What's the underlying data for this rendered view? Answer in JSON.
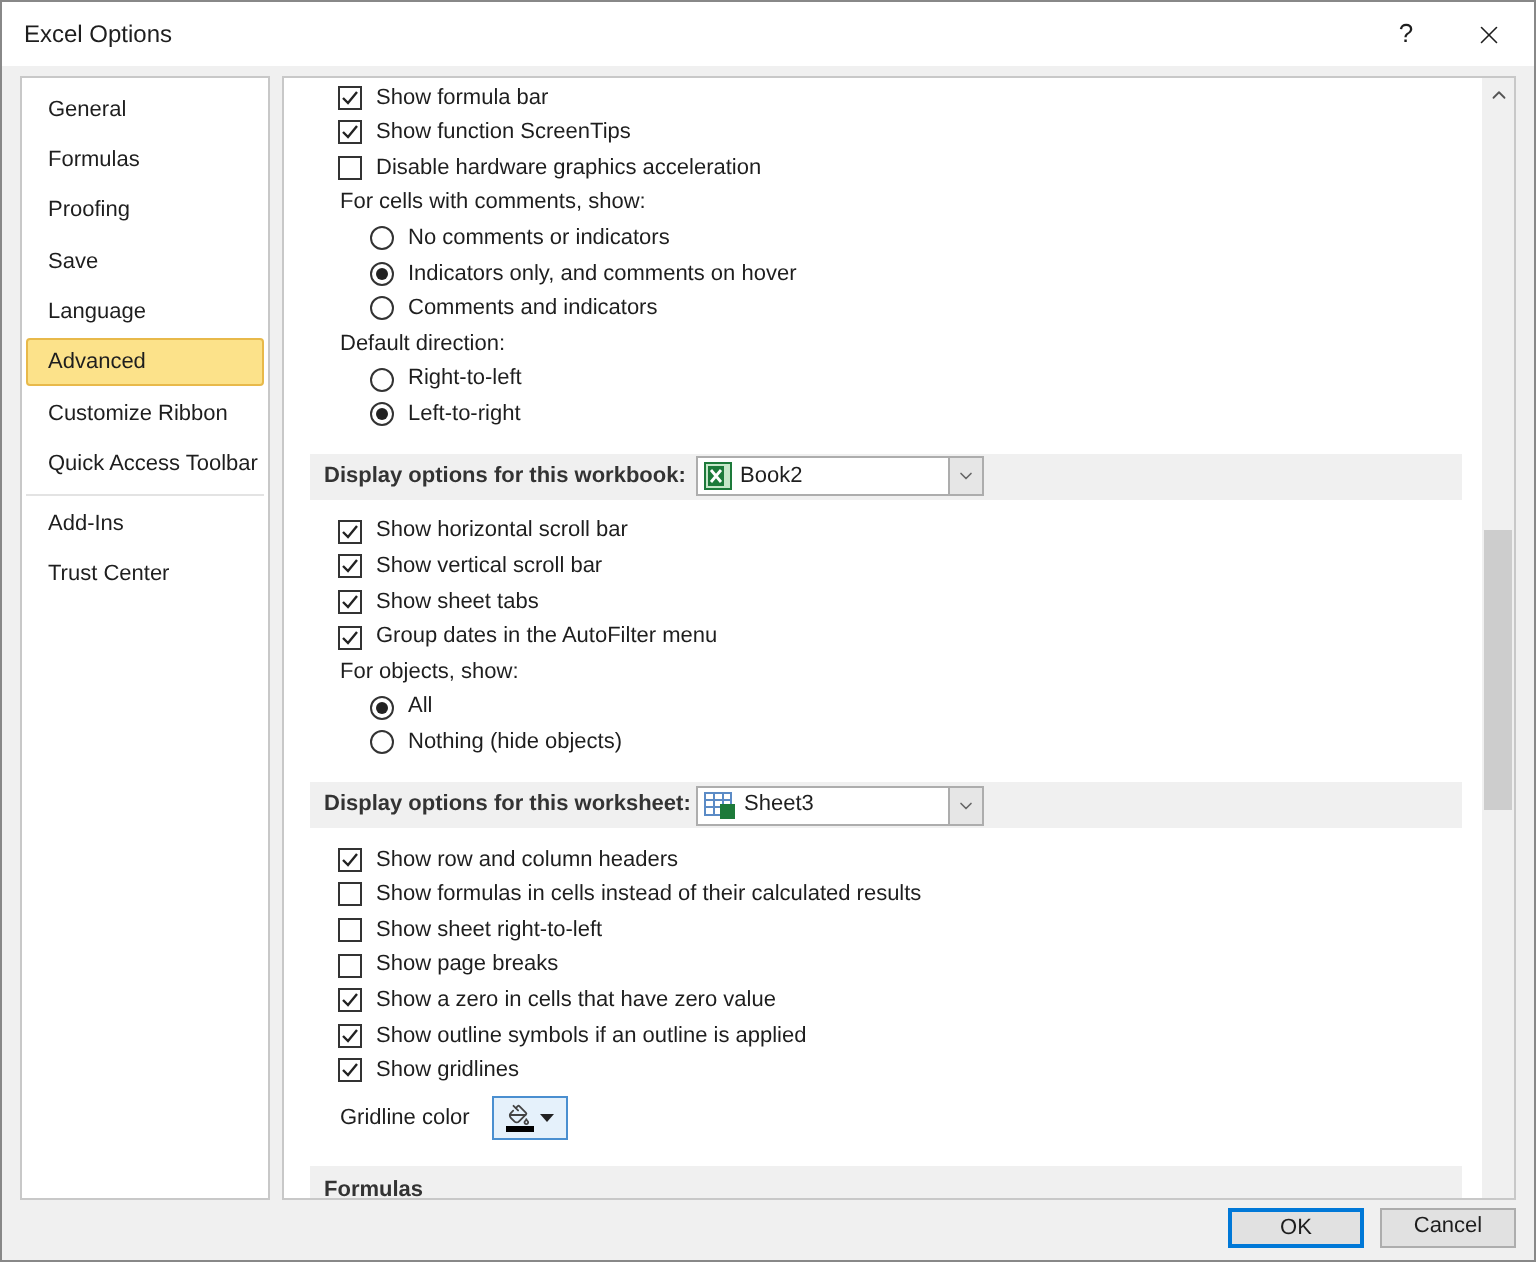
{
  "window": {
    "title": "Excel Options",
    "help": "?"
  },
  "sidebar": {
    "groups": [
      {
        "items": [
          {
            "label": "General",
            "selected": false
          },
          {
            "label": "Formulas",
            "selected": false
          },
          {
            "label": "Proofing",
            "selected": false
          },
          {
            "label": "Save",
            "selected": false
          },
          {
            "label": "Language",
            "selected": false
          },
          {
            "label": "Advanced",
            "selected": true
          },
          {
            "label": "Customize Ribbon",
            "selected": false
          },
          {
            "label": "Quick Access Toolbar",
            "selected": false
          }
        ]
      },
      {
        "items": [
          {
            "label": "Add-Ins",
            "selected": false
          },
          {
            "label": "Trust Center",
            "selected": false
          }
        ]
      }
    ]
  },
  "options": [
    {
      "kind": "checkbox",
      "label": "Show formula bar",
      "checked": true
    },
    {
      "kind": "checkbox",
      "label": "Show function ScreenTips",
      "checked": true
    },
    {
      "kind": "checkbox",
      "label": "Disable hardware graphics acceleration",
      "checked": false
    },
    {
      "kind": "label",
      "label": "For cells with comments, show:"
    },
    {
      "kind": "radio",
      "label": "No comments or indicators",
      "selected": false
    },
    {
      "kind": "radio",
      "label": "Indicators only, and comments on hover",
      "selected": true
    },
    {
      "kind": "radio",
      "label": "Comments and indicators",
      "selected": false
    },
    {
      "kind": "label",
      "label": "Default direction:"
    },
    {
      "kind": "radio",
      "label": "Right-to-left",
      "selected": false
    },
    {
      "kind": "radio",
      "label": "Left-to-right",
      "selected": true
    },
    {
      "kind": "section",
      "label": "Display options for this workbook:",
      "dropdown": {
        "value": "Book2",
        "kind": "workbook"
      }
    },
    {
      "kind": "checkbox",
      "label": "Show horizontal scroll bar",
      "checked": true
    },
    {
      "kind": "checkbox",
      "label": "Show vertical scroll bar",
      "checked": true
    },
    {
      "kind": "checkbox",
      "label": "Show sheet tabs",
      "checked": true
    },
    {
      "kind": "checkbox",
      "label": "Group dates in the AutoFilter menu",
      "checked": true
    },
    {
      "kind": "label",
      "label": "For objects, show:"
    },
    {
      "kind": "radio",
      "label": "All",
      "selected": true
    },
    {
      "kind": "radio",
      "label": "Nothing (hide objects)",
      "selected": false
    },
    {
      "kind": "section",
      "label": "Display options for this worksheet:",
      "dropdown": {
        "value": "Sheet3",
        "kind": "worksheet"
      }
    },
    {
      "kind": "checkbox",
      "label": "Show row and column headers",
      "checked": true
    },
    {
      "kind": "checkbox",
      "label": "Show formulas in cells instead of their calculated results",
      "checked": false
    },
    {
      "kind": "checkbox",
      "label": "Show sheet right-to-left",
      "checked": false
    },
    {
      "kind": "checkbox",
      "label": "Show page breaks",
      "checked": false
    },
    {
      "kind": "checkbox",
      "label": "Show a zero in cells that have zero value",
      "checked": true
    },
    {
      "kind": "checkbox",
      "label": "Show outline symbols if an outline is applied",
      "checked": true
    },
    {
      "kind": "checkbox",
      "label": "Show gridlines",
      "checked": true
    },
    {
      "kind": "color",
      "label": "Gridline color",
      "color": "#000000"
    },
    {
      "kind": "section",
      "label": "Formulas"
    }
  ],
  "buttons": [
    {
      "label": "OK",
      "default": true
    },
    {
      "label": "Cancel",
      "default": false
    }
  ]
}
